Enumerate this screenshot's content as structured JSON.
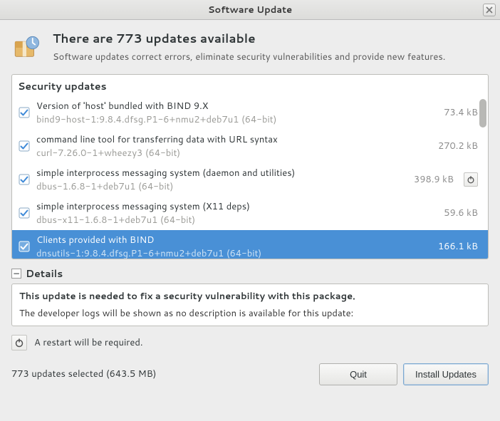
{
  "window": {
    "title": "Software Update"
  },
  "header": {
    "title": "There are 773 updates available",
    "subtitle": "Software updates correct errors, eliminate security vulnerabilities and provide new features."
  },
  "group_label": "Security updates",
  "items": [
    {
      "title": "Version of 'host' bundled with BIND 9.X",
      "pkg": "bind9-host-1:9.8.4.dfsg.P1-6+nmu2+deb7u1 (64-bit)",
      "size": "73.4 kB",
      "restart": false,
      "selected": false
    },
    {
      "title": "command line tool for transferring data with URL syntax",
      "pkg": "curl-7.26.0-1+wheezy3 (64-bit)",
      "size": "270.2 kB",
      "restart": false,
      "selected": false
    },
    {
      "title": "simple interprocess messaging system (daemon and utilities)",
      "pkg": "dbus-1.6.8-1+deb7u1 (64-bit)",
      "size": "398.9 kB",
      "restart": true,
      "selected": false
    },
    {
      "title": "simple interprocess messaging system (X11 deps)",
      "pkg": "dbus-x11-1.6.8-1+deb7u1 (64-bit)",
      "size": "59.6 kB",
      "restart": false,
      "selected": false
    },
    {
      "title": "Clients provided with BIND",
      "pkg": "dnsutils-1:9.8.4.dfsg.P1-6+nmu2+deb7u1 (64-bit)",
      "size": "166.1 kB",
      "restart": false,
      "selected": true
    }
  ],
  "details": {
    "section_label": "Details",
    "title": "This update is needed to fix a security vulnerability with this package.",
    "description": "The developer logs will be shown as no description is available for this update:"
  },
  "restart_note": "A restart will be required.",
  "footer": {
    "status": "773 updates selected (643.5 MB)",
    "quit": "Quit",
    "install": "Install Updates"
  }
}
